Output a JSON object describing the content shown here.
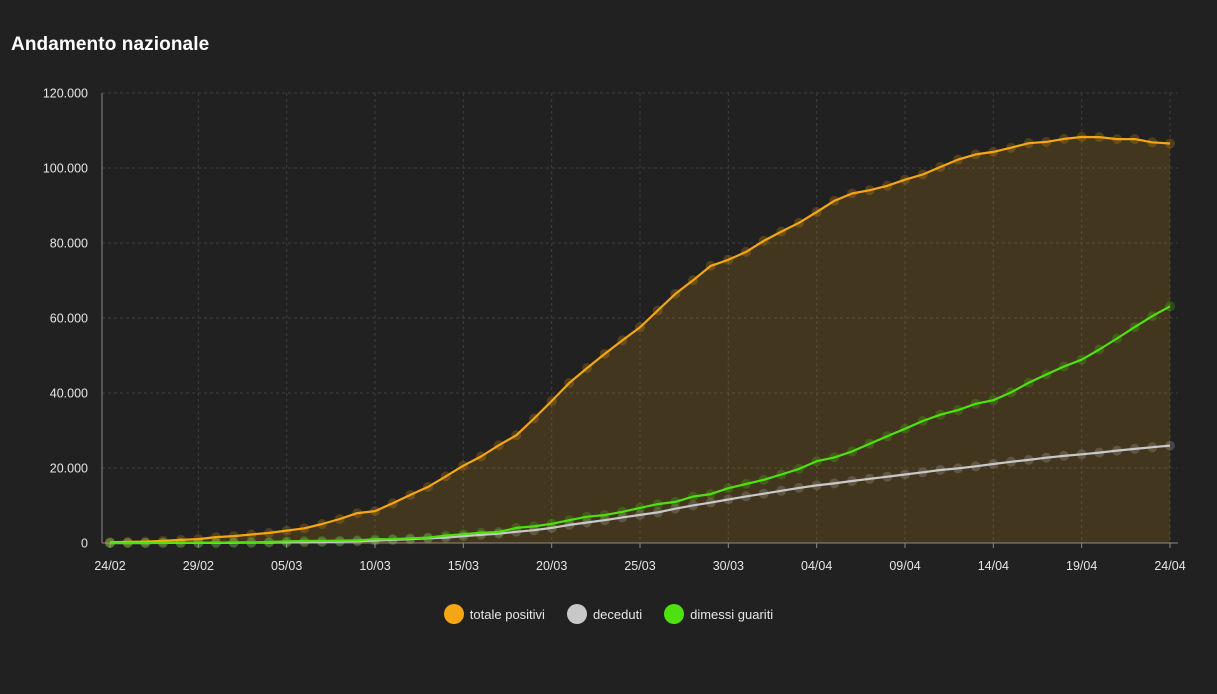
{
  "header": {
    "title": "Andamento nazionale"
  },
  "chart_data": {
    "type": "line",
    "title": "Andamento nazionale",
    "xlabel": "",
    "ylabel": "",
    "ylim": [
      0,
      120000
    ],
    "y_ticks": [
      "0",
      "20.000",
      "40.000",
      "60.000",
      "80.000",
      "100.000",
      "120.000"
    ],
    "x_ticks": [
      "24/02",
      "29/02",
      "05/03",
      "10/03",
      "15/03",
      "20/03",
      "25/03",
      "30/03",
      "04/04",
      "09/04",
      "14/04",
      "19/04",
      "24/04"
    ],
    "grid": true,
    "legend_position": "bottom-center",
    "x": [
      "24/02",
      "25/02",
      "26/02",
      "27/02",
      "28/02",
      "29/02",
      "01/03",
      "02/03",
      "03/03",
      "04/03",
      "05/03",
      "06/03",
      "07/03",
      "08/03",
      "09/03",
      "10/03",
      "11/03",
      "12/03",
      "13/03",
      "14/03",
      "15/03",
      "16/03",
      "17/03",
      "18/03",
      "19/03",
      "20/03",
      "21/03",
      "22/03",
      "23/03",
      "24/03",
      "25/03",
      "26/03",
      "27/03",
      "28/03",
      "29/03",
      "30/03",
      "31/03",
      "01/04",
      "02/04",
      "03/04",
      "04/04",
      "05/04",
      "06/04",
      "07/04",
      "08/04",
      "09/04",
      "10/04",
      "11/04",
      "12/04",
      "13/04",
      "14/04",
      "15/04",
      "16/04",
      "17/04",
      "18/04",
      "19/04",
      "20/04",
      "21/04",
      "22/04",
      "23/04",
      "24/04"
    ],
    "series": [
      {
        "name": "totale positivi",
        "color": "#f5a613",
        "fill": true,
        "values": [
          221,
          311,
          385,
          588,
          821,
          1049,
          1577,
          1835,
          2263,
          2706,
          3296,
          3916,
          5061,
          6387,
          7985,
          8514,
          10590,
          12839,
          14955,
          17750,
          20603,
          23073,
          26062,
          28710,
          33190,
          37860,
          42681,
          46638,
          50418,
          54030,
          57521,
          62013,
          66414,
          70065,
          73880,
          75528,
          77635,
          80572,
          83049,
          85388,
          88274,
          91246,
          93187,
          94067,
          95262,
          96877,
          98273,
          100269,
          102253,
          103616,
          104291,
          105418,
          106607,
          106962,
          107771,
          108257,
          108237,
          107709,
          107699,
          106848,
          106527
        ]
      },
      {
        "name": "deceduti",
        "color": "#c8c8c8",
        "fill": false,
        "values": [
          7,
          10,
          12,
          17,
          21,
          29,
          34,
          52,
          79,
          107,
          148,
          197,
          233,
          366,
          463,
          631,
          827,
          1016,
          1266,
          1441,
          1809,
          2158,
          2503,
          2978,
          3405,
          4032,
          4825,
          5476,
          6077,
          6820,
          7503,
          8165,
          9134,
          10023,
          10779,
          11591,
          12428,
          13155,
          13915,
          14681,
          15362,
          15887,
          16523,
          17127,
          17669,
          18279,
          18849,
          19468,
          19899,
          20465,
          21067,
          21645,
          22170,
          22745,
          23227,
          23660,
          24114,
          24648,
          25085,
          25549,
          25969
        ]
      },
      {
        "name": "dimessi guariti",
        "color": "#4fe00f",
        "fill": false,
        "values": [
          1,
          1,
          3,
          45,
          46,
          50,
          83,
          149,
          160,
          276,
          414,
          523,
          589,
          622,
          724,
          1004,
          1045,
          1258,
          1439,
          1966,
          2335,
          2749,
          2941,
          4025,
          4440,
          5129,
          6072,
          7024,
          7432,
          8326,
          9362,
          10361,
          10950,
          12384,
          13030,
          14620,
          15729,
          16847,
          18278,
          19758,
          21815,
          22837,
          24392,
          26491,
          28470,
          30455,
          32534,
          34211,
          35435,
          37130,
          38092,
          40164,
          42727,
          44927,
          47055,
          48877,
          51600,
          54543,
          57576,
          60498,
          63120
        ]
      }
    ]
  }
}
